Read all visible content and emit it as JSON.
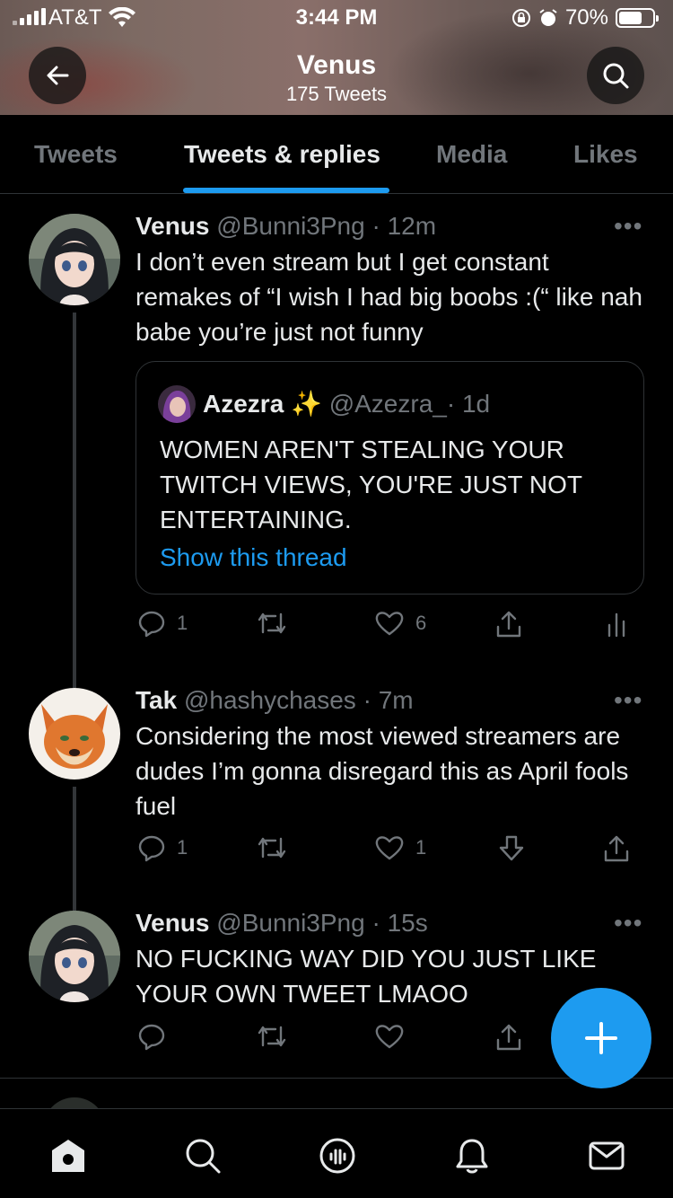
{
  "status_bar": {
    "carrier": "AT&T",
    "time": "3:44 PM",
    "battery": "70%",
    "battery_level": 0.7
  },
  "header": {
    "title": "Venus",
    "subtitle": "175 Tweets",
    "back_icon": "arrow-left-icon",
    "search_icon": "search-icon"
  },
  "tabs": [
    {
      "label": "Tweets",
      "active": false
    },
    {
      "label": "Tweets & replies",
      "active": true
    },
    {
      "label": "Media",
      "active": false
    },
    {
      "label": "Likes",
      "active": false
    }
  ],
  "tweets": [
    {
      "name": "Venus",
      "handle": "@Bunni3Png",
      "time": "· 12m",
      "text": "I don’t even stream but I get constant remakes of “I wish I had big boobs :(“ like nah babe you’re just not funny",
      "quote": {
        "name": "Azezra",
        "emoji": "✨",
        "handle": "@Azezra_",
        "time": "· 1d",
        "text": "WOMEN AREN'T STEALING YOUR TWITCH VIEWS, YOU'RE JUST NOT ENTERTAINING.",
        "link": "Show this thread"
      },
      "replies": "1",
      "retweets": "",
      "likes": "6"
    },
    {
      "name": "Tak",
      "handle": "@hashychases",
      "time": "· 7m",
      "text": "Considering the most viewed streamers are dudes I’m gonna disregard this as April fools fuel",
      "replies": "1",
      "retweets": "",
      "likes": "1"
    },
    {
      "name": "Venus",
      "handle": "@Bunni3Png",
      "time": "· 15s",
      "text": "NO FUCKING WAY DID YOU JUST LIKE YOUR OWN TWEET LMAOO",
      "replies": "",
      "retweets": "",
      "likes": ""
    }
  ],
  "more_label": "•••",
  "colors": {
    "accent": "#1d9bf0",
    "muted": "#71767b",
    "background": "#000000",
    "text": "#e7e9ea"
  },
  "bottom_nav": [
    "home-icon",
    "search-icon",
    "spaces-icon",
    "notifications-icon",
    "messages-icon"
  ],
  "fab_icon": "plus-icon"
}
